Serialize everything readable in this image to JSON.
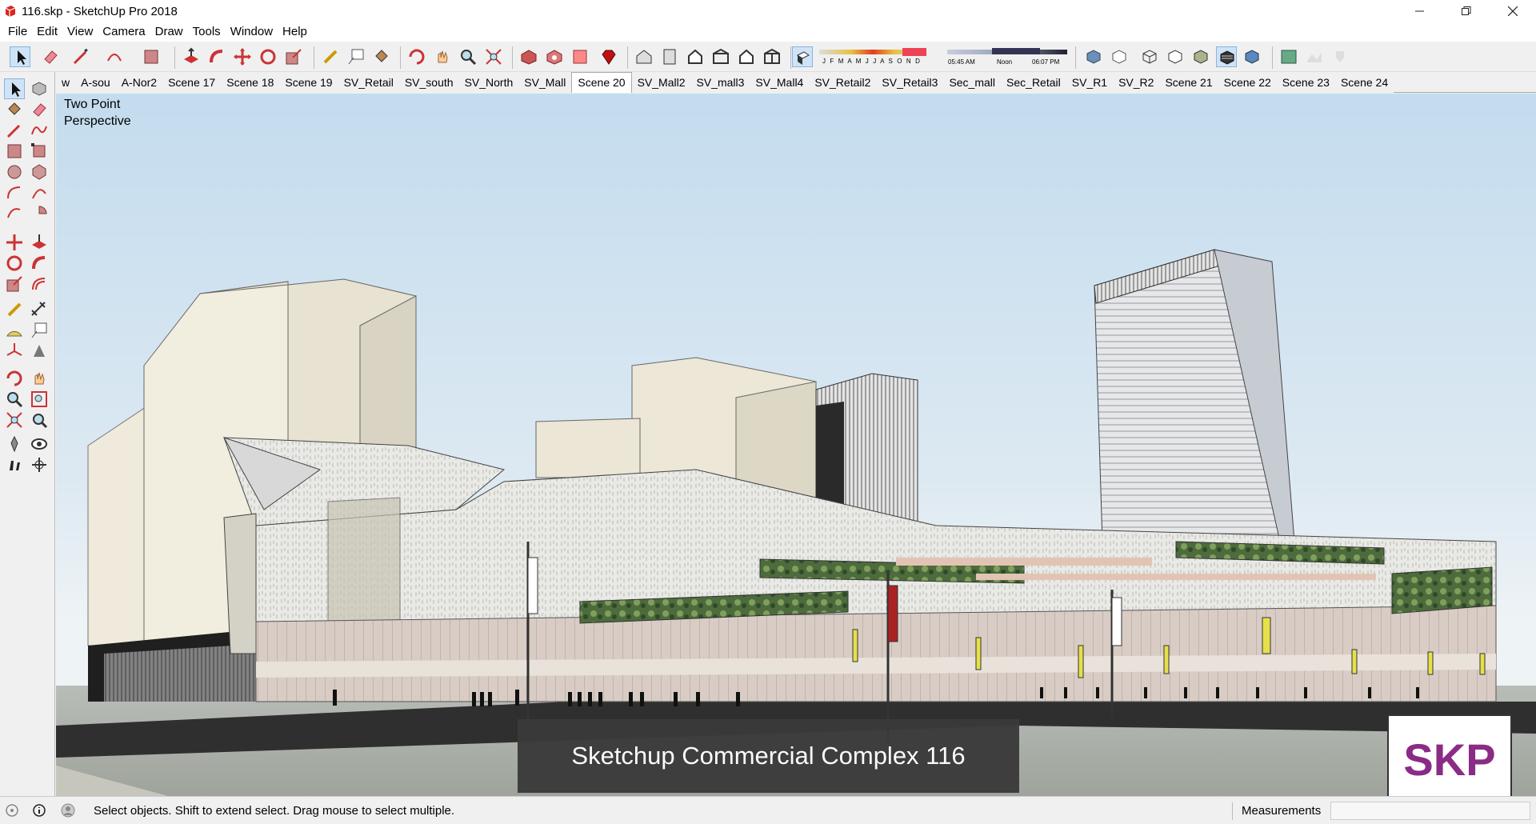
{
  "window": {
    "title": "116.skp - SketchUp Pro 2018"
  },
  "menu": [
    "File",
    "Edit",
    "View",
    "Camera",
    "Draw",
    "Tools",
    "Window",
    "Help"
  ],
  "shadow": {
    "months": "J F M A M J J A S O N D",
    "time_start": "05:45 AM",
    "time_mid": "Noon",
    "time_end": "06:07 PM"
  },
  "scenes": {
    "tabs": [
      "w",
      "A-sou",
      "A-Nor2",
      "Scene 17",
      "Scene 18",
      "Scene 19",
      "SV_Retail",
      "SV_south",
      "SV_North",
      "SV_Mall",
      "Scene 20",
      "SV_Mall2",
      "SV_mall3",
      "SV_Mall4",
      "SV_Retail2",
      "SV_Retail3",
      "Sec_mall",
      "Sec_Retail",
      "SV_R1",
      "SV_R2",
      "Scene 21",
      "Scene 22",
      "Scene 23",
      "Scene 24"
    ],
    "active": "Scene 20"
  },
  "viewport": {
    "camera_label": "Two Point\nPerspective",
    "caption": "Sketchup Commercial Complex 116",
    "logo": "SKP"
  },
  "status": {
    "text": "Select objects. Shift to extend select. Drag mouse to select multiple.",
    "measurements_label": "Measurements",
    "measurements_value": ""
  },
  "colors": {
    "logo": "#8a2b86",
    "caption_bg": "#3a3a3a",
    "sky": "#c3dcee"
  }
}
